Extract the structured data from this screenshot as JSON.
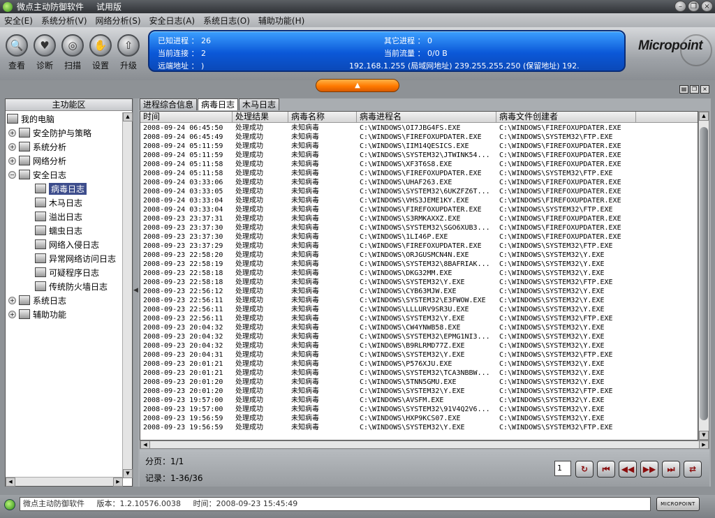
{
  "window": {
    "title": "微点主动防御软件",
    "edition": "试用版"
  },
  "menu": [
    "安全(E)",
    "系统分析(V)",
    "网络分析(S)",
    "安全日志(A)",
    "系统日志(O)",
    "辅助功能(H)"
  ],
  "toolbar": [
    {
      "label": "查看",
      "icon": "magnifier-icon",
      "glyph": "🔍"
    },
    {
      "label": "诊断",
      "icon": "heart-icon",
      "glyph": "♥"
    },
    {
      "label": "扫描",
      "icon": "target-icon",
      "glyph": "◎"
    },
    {
      "label": "设置",
      "icon": "hand-icon",
      "glyph": "✋"
    },
    {
      "label": "升级",
      "icon": "upgrade-icon",
      "glyph": "⇧"
    }
  ],
  "info": {
    "known_proc_label": "已知进程 ：",
    "known_proc_value": "26",
    "other_proc_label": "其它进程 ：",
    "other_proc_value": "0",
    "conn_label": "当前连接 ：",
    "conn_value": "2",
    "traffic_label": "当前流量 ：",
    "traffic_value": "0/0 B",
    "remote_label": "远端地址 ：",
    "remote_value": ")",
    "remote_list": "192.168.1.255 (局域网地址)     239.255.255.250 (保留地址)     192."
  },
  "logo": "Micropoint",
  "left": {
    "header": "主功能区",
    "tree": [
      {
        "label": "我的电脑",
        "level": 0,
        "exp": ""
      },
      {
        "label": "安全防护与策略",
        "level": 1,
        "exp": "+"
      },
      {
        "label": "系统分析",
        "level": 1,
        "exp": "+"
      },
      {
        "label": "网络分析",
        "level": 1,
        "exp": "+"
      },
      {
        "label": "安全日志",
        "level": 1,
        "exp": "−"
      },
      {
        "label": "病毒日志",
        "level": 2,
        "exp": "",
        "selected": true
      },
      {
        "label": "木马日志",
        "level": 2,
        "exp": ""
      },
      {
        "label": "溢出日志",
        "level": 2,
        "exp": ""
      },
      {
        "label": "蠕虫日志",
        "level": 2,
        "exp": ""
      },
      {
        "label": "网络入侵日志",
        "level": 2,
        "exp": ""
      },
      {
        "label": "异常网络访问日志",
        "level": 2,
        "exp": ""
      },
      {
        "label": "可疑程序日志",
        "level": 2,
        "exp": ""
      },
      {
        "label": "传统防火墙日志",
        "level": 2,
        "exp": ""
      },
      {
        "label": "系统日志",
        "level": 1,
        "exp": "+"
      },
      {
        "label": "辅助功能",
        "level": 1,
        "exp": "+"
      }
    ]
  },
  "tabs": [
    {
      "label": "进程综合信息",
      "active": false
    },
    {
      "label": "病毒日志",
      "active": true
    },
    {
      "label": "木马日志",
      "active": false
    }
  ],
  "grid": {
    "columns": [
      "时间",
      "处理结果",
      "病毒名称",
      "病毒进程名",
      "病毒文件创建者"
    ],
    "rows": [
      [
        "2008-09-24 06:45:50",
        "处理成功",
        "未知病毒",
        "C:\\WINDOWS\\OI7JBG4FS.EXE",
        "C:\\WINDOWS\\FIREFOXUPDATER.EXE"
      ],
      [
        "2008-09-24 06:45:49",
        "处理成功",
        "未知病毒",
        "C:\\WINDOWS\\FIREFOXUPDATER.EXE",
        "C:\\WINDOWS\\SYSTEM32\\FTP.EXE"
      ],
      [
        "2008-09-24 05:11:59",
        "处理成功",
        "未知病毒",
        "C:\\WINDOWS\\IIM14QESICS.EXE",
        "C:\\WINDOWS\\FIREFOXUPDATER.EXE"
      ],
      [
        "2008-09-24 05:11:59",
        "处理成功",
        "未知病毒",
        "C:\\WINDOWS\\SYSTEM32\\JTWINK54...",
        "C:\\WINDOWS\\FIREFOXUPDATER.EXE"
      ],
      [
        "2008-09-24 05:11:58",
        "处理成功",
        "未知病毒",
        "C:\\WINDOWS\\XF3T6S8.EXE",
        "C:\\WINDOWS\\FIREFOXUPDATER.EXE"
      ],
      [
        "2008-09-24 05:11:58",
        "处理成功",
        "未知病毒",
        "C:\\WINDOWS\\FIREFOXUPDATER.EXE",
        "C:\\WINDOWS\\SYSTEM32\\FTP.EXE"
      ],
      [
        "2008-09-24 03:33:06",
        "处理成功",
        "未知病毒",
        "C:\\WINDOWS\\UHAF263.EXE",
        "C:\\WINDOWS\\FIREFOXUPDATER.EXE"
      ],
      [
        "2008-09-24 03:33:05",
        "处理成功",
        "未知病毒",
        "C:\\WINDOWS\\SYSTEM32\\6UKZFZ6T...",
        "C:\\WINDOWS\\FIREFOXUPDATER.EXE"
      ],
      [
        "2008-09-24 03:33:04",
        "处理成功",
        "未知病毒",
        "C:\\WINDOWS\\VHS3JEME1KY.EXE",
        "C:\\WINDOWS\\FIREFOXUPDATER.EXE"
      ],
      [
        "2008-09-24 03:33:04",
        "处理成功",
        "未知病毒",
        "C:\\WINDOWS\\FIREFOXUPDATER.EXE",
        "C:\\WINDOWS\\SYSTEM32\\FTP.EXE"
      ],
      [
        "2008-09-23 23:37:31",
        "处理成功",
        "未知病毒",
        "C:\\WINDOWS\\S3RMKAXXZ.EXE",
        "C:\\WINDOWS\\FIREFOXUPDATER.EXE"
      ],
      [
        "2008-09-23 23:37:30",
        "处理成功",
        "未知病毒",
        "C:\\WINDOWS\\SYSTEM32\\SGO6XUB3...",
        "C:\\WINDOWS\\FIREFOXUPDATER.EXE"
      ],
      [
        "2008-09-23 23:37:30",
        "处理成功",
        "未知病毒",
        "C:\\WINDOWS\\1LI46P.EXE",
        "C:\\WINDOWS\\FIREFOXUPDATER.EXE"
      ],
      [
        "2008-09-23 23:37:29",
        "处理成功",
        "未知病毒",
        "C:\\WINDOWS\\FIREFOXUPDATER.EXE",
        "C:\\WINDOWS\\SYSTEM32\\FTP.EXE"
      ],
      [
        "2008-09-23 22:58:20",
        "处理成功",
        "未知病毒",
        "C:\\WINDOWS\\ORJGUSMCN4N.EXE",
        "C:\\WINDOWS\\SYSTEM32\\Y.EXE"
      ],
      [
        "2008-09-23 22:58:19",
        "处理成功",
        "未知病毒",
        "C:\\WINDOWS\\SYSTEM32\\8BAFRIAK...",
        "C:\\WINDOWS\\SYSTEM32\\Y.EXE"
      ],
      [
        "2008-09-23 22:58:18",
        "处理成功",
        "未知病毒",
        "C:\\WINDOWS\\DKG32MM.EXE",
        "C:\\WINDOWS\\SYSTEM32\\Y.EXE"
      ],
      [
        "2008-09-23 22:58:18",
        "处理成功",
        "未知病毒",
        "C:\\WINDOWS\\SYSTEM32\\Y.EXE",
        "C:\\WINDOWS\\SYSTEM32\\FTP.EXE"
      ],
      [
        "2008-09-23 22:56:12",
        "处理成功",
        "未知病毒",
        "C:\\WINDOWS\\CYB63MJW.EXE",
        "C:\\WINDOWS\\SYSTEM32\\Y.EXE"
      ],
      [
        "2008-09-23 22:56:11",
        "处理成功",
        "未知病毒",
        "C:\\WINDOWS\\SYSTEM32\\E3FWOW.EXE",
        "C:\\WINDOWS\\SYSTEM32\\Y.EXE"
      ],
      [
        "2008-09-23 22:56:11",
        "处理成功",
        "未知病毒",
        "C:\\WINDOWS\\LLLURV9SR3U.EXE",
        "C:\\WINDOWS\\SYSTEM32\\Y.EXE"
      ],
      [
        "2008-09-23 22:56:11",
        "处理成功",
        "未知病毒",
        "C:\\WINDOWS\\SYSTEM32\\Y.EXE",
        "C:\\WINDOWS\\SYSTEM32\\FTP.EXE"
      ],
      [
        "2008-09-23 20:04:32",
        "处理成功",
        "未知病毒",
        "C:\\WINDOWS\\CW4YNWB58.EXE",
        "C:\\WINDOWS\\SYSTEM32\\Y.EXE"
      ],
      [
        "2008-09-23 20:04:32",
        "处理成功",
        "未知病毒",
        "C:\\WINDOWS\\SYSTEM32\\EPMG1NI3...",
        "C:\\WINDOWS\\SYSTEM32\\Y.EXE"
      ],
      [
        "2008-09-23 20:04:32",
        "处理成功",
        "未知病毒",
        "C:\\WINDOWS\\B9RLRMD77Z.EXE",
        "C:\\WINDOWS\\SYSTEM32\\Y.EXE"
      ],
      [
        "2008-09-23 20:04:31",
        "处理成功",
        "未知病毒",
        "C:\\WINDOWS\\SYSTEM32\\Y.EXE",
        "C:\\WINDOWS\\SYSTEM32\\FTP.EXE"
      ],
      [
        "2008-09-23 20:01:21",
        "处理成功",
        "未知病毒",
        "C:\\WINDOWS\\P576XJU.EXE",
        "C:\\WINDOWS\\SYSTEM32\\Y.EXE"
      ],
      [
        "2008-09-23 20:01:21",
        "处理成功",
        "未知病毒",
        "C:\\WINDOWS\\SYSTEM32\\TCA3NBBW...",
        "C:\\WINDOWS\\SYSTEM32\\Y.EXE"
      ],
      [
        "2008-09-23 20:01:20",
        "处理成功",
        "未知病毒",
        "C:\\WINDOWS\\5TNN5GMU.EXE",
        "C:\\WINDOWS\\SYSTEM32\\Y.EXE"
      ],
      [
        "2008-09-23 20:01:20",
        "处理成功",
        "未知病毒",
        "C:\\WINDOWS\\SYSTEM32\\Y.EXE",
        "C:\\WINDOWS\\SYSTEM32\\FTP.EXE"
      ],
      [
        "2008-09-23 19:57:00",
        "处理成功",
        "未知病毒",
        "C:\\WINDOWS\\AVSFM.EXE",
        "C:\\WINDOWS\\SYSTEM32\\Y.EXE"
      ],
      [
        "2008-09-23 19:57:00",
        "处理成功",
        "未知病毒",
        "C:\\WINDOWS\\SYSTEM32\\91V4Q2V6...",
        "C:\\WINDOWS\\SYSTEM32\\Y.EXE"
      ],
      [
        "2008-09-23 19:56:59",
        "处理成功",
        "未知病毒",
        "C:\\WINDOWS\\HXP9KCS07.EXE",
        "C:\\WINDOWS\\SYSTEM32\\Y.EXE"
      ],
      [
        "2008-09-23 19:56:59",
        "处理成功",
        "未知病毒",
        "C:\\WINDOWS\\SYSTEM32\\Y.EXE",
        "C:\\WINDOWS\\SYSTEM32\\FTP.EXE"
      ]
    ]
  },
  "footer": {
    "page_label": "分页：1/1",
    "record_label": "记录：1-36/36",
    "page_input": "1"
  },
  "nav": [
    {
      "name": "refresh-icon",
      "glyph": "↻"
    },
    {
      "name": "first-page-icon",
      "glyph": "⏮"
    },
    {
      "name": "prev-page-icon",
      "glyph": "◀◀"
    },
    {
      "name": "next-page-icon",
      "glyph": "▶▶"
    },
    {
      "name": "last-page-icon",
      "glyph": "⏭"
    },
    {
      "name": "sync-icon",
      "glyph": "⇄"
    }
  ],
  "status": {
    "app": "微点主动防御软件",
    "version": "版本：1.2.10576.0038",
    "time": "时间：2008-09-23 15:45:49",
    "brand_button": "MICROPOINT"
  }
}
